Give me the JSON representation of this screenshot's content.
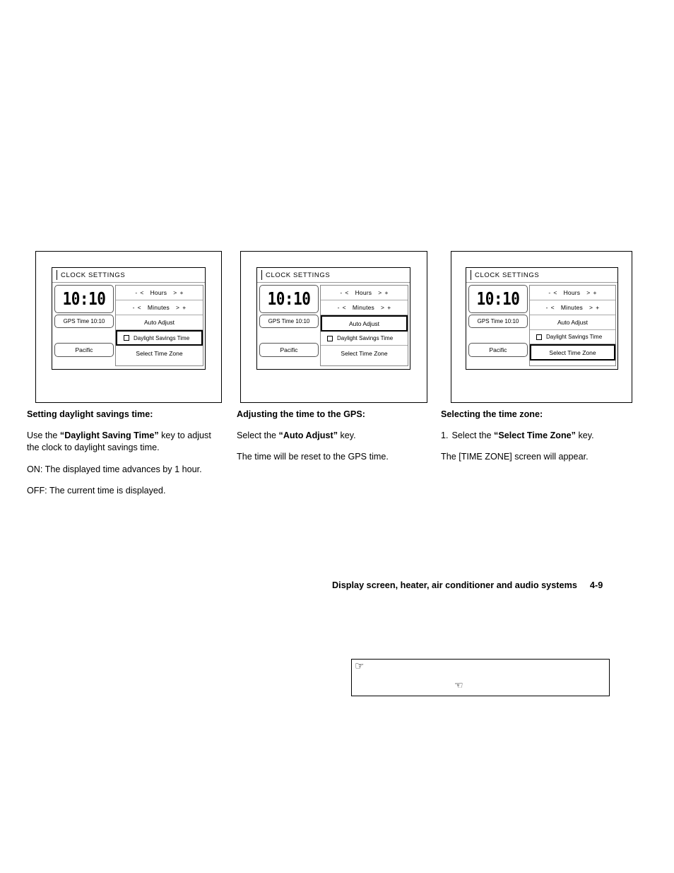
{
  "page": {
    "footer_title": "Display screen, heater, air conditioner and audio systems",
    "page_number": "4-9"
  },
  "screen_common": {
    "title": "CLOCK SETTINGS",
    "clock_time": "10:10",
    "gps_time_label": "GPS Time  10:10",
    "timezone_value": "Pacific",
    "hours_minus": "-",
    "hours_prev": "<",
    "hours_label": "Hours",
    "hours_next": ">",
    "hours_plus": "+",
    "minutes_minus": "-",
    "minutes_prev": "<",
    "minutes_label": "Minutes",
    "minutes_next": ">",
    "minutes_plus": "+",
    "auto_adjust_label": "Auto Adjust",
    "daylight_savings_label": "Daylight Savings Time",
    "select_time_zone_label": "Select Time Zone"
  },
  "figures": [
    {
      "id": "figure-daylight-savings",
      "selected_key": "daylight-savings-time"
    },
    {
      "id": "figure-auto-adjust",
      "selected_key": "auto-adjust"
    },
    {
      "id": "figure-select-time-zone",
      "selected_key": "select-time-zone"
    }
  ],
  "sections": [
    {
      "heading": "Setting daylight savings time:",
      "p1_a": "Use the ",
      "p1_b": "“Daylight Saving Time”",
      "p1_c": " key to adjust the clock to daylight savings time.",
      "p2": "ON: The displayed time advances by 1 hour.",
      "p3": "OFF: The current time is displayed."
    },
    {
      "heading": "Adjusting the time to the GPS:",
      "p1_a": "Select the ",
      "p1_b": "“Auto Adjust”",
      "p1_c": " key.",
      "p2": "The time will be reset to the GPS time."
    },
    {
      "heading": "Selecting the time zone:",
      "num": "1.",
      "p1_a": "Select the ",
      "p1_b": "“Select Time Zone”",
      "p1_c": " key.",
      "p2": "The [TIME ZONE] screen will appear."
    }
  ],
  "bottom_box": {
    "hand_right_icon": "pointing-hand-right-icon",
    "hand_left_icon": "pointing-hand-left-icon",
    "hand_right_glyph": "☞",
    "hand_left_glyph": "☜"
  }
}
